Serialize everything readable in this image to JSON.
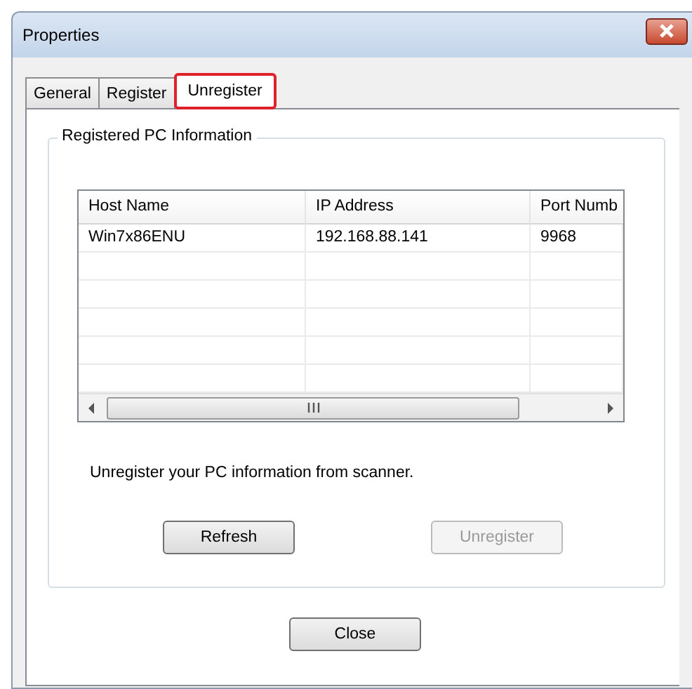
{
  "window": {
    "title": "Properties"
  },
  "tabs": [
    {
      "label": "General",
      "selected": false,
      "highlighted": false
    },
    {
      "label": "Register",
      "selected": false,
      "highlighted": false
    },
    {
      "label": "Unregister",
      "selected": true,
      "highlighted": true
    }
  ],
  "group": {
    "title": "Registered PC Information"
  },
  "table": {
    "columns": [
      "Host Name",
      "IP Address",
      "Port Numb"
    ],
    "rows": [
      [
        "Win7x86ENU",
        "192.168.88.141",
        "9968"
      ]
    ]
  },
  "message": "Unregister your PC information from scanner.",
  "buttons": [
    {
      "label": "Refresh",
      "disabled": false
    },
    {
      "label": "Unregister",
      "disabled": true
    }
  ],
  "close_button": {
    "label": "Close"
  }
}
